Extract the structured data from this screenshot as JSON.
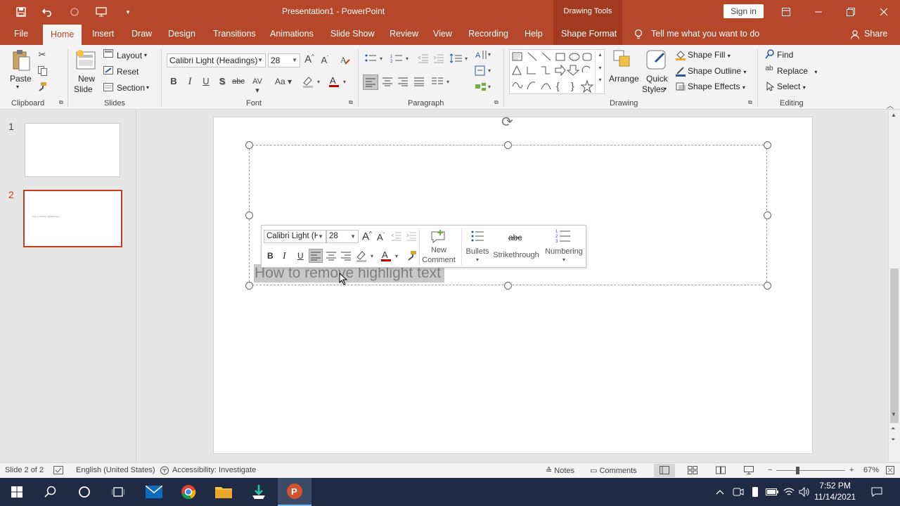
{
  "window": {
    "title": "Presentation1  -  PowerPoint",
    "context_tab_group": "Drawing Tools",
    "signin_label": "Sign in"
  },
  "tabs": [
    "File",
    "Home",
    "Insert",
    "Draw",
    "Design",
    "Transitions",
    "Animations",
    "Slide Show",
    "Review",
    "View",
    "Recording",
    "Help",
    "Shape Format"
  ],
  "tell_me": "Tell me what you want to do",
  "share_label": "Share",
  "ribbon": {
    "clipboard": {
      "paste": "Paste",
      "group": "Clipboard"
    },
    "slides": {
      "new_slide_1": "New",
      "new_slide_2": "Slide",
      "layout": "Layout",
      "reset": "Reset",
      "section": "Section",
      "group": "Slides"
    },
    "font": {
      "font_name": "Calibri Light (Headings)",
      "font_size": "28",
      "bold": "B",
      "italic": "I",
      "underline": "U",
      "shadow": "S",
      "strike": "abc",
      "spacing": "AV",
      "case": "Aa",
      "group": "Font"
    },
    "paragraph": {
      "group": "Paragraph"
    },
    "drawing": {
      "arrange": "Arrange",
      "quick_styles_1": "Quick",
      "quick_styles_2": "Styles",
      "shape_fill": "Shape Fill",
      "shape_outline": "Shape Outline",
      "shape_effects": "Shape Effects",
      "group": "Drawing"
    },
    "editing": {
      "find": "Find",
      "replace": "Replace",
      "select": "Select",
      "group": "Editing"
    }
  },
  "thumbnails": [
    {
      "num": "1",
      "text": ""
    },
    {
      "num": "2",
      "text": "How to remove highlight text"
    }
  ],
  "slide": {
    "text": "How to remove highlight text"
  },
  "minibar": {
    "font_name": "Calibri Light (H",
    "font_size": "28",
    "new_comment_1": "New",
    "new_comment_2": "Comment",
    "bullets": "Bullets",
    "strikethrough": "Strikethrough",
    "numbering": "Numbering",
    "bold": "B",
    "italic": "I",
    "underline": "U"
  },
  "status": {
    "slide_info": "Slide 2 of 2",
    "language": "English (United States)",
    "accessibility": "Accessibility: Investigate",
    "notes": "Notes",
    "comments": "Comments",
    "zoom": "67%"
  },
  "taskbar": {
    "time": "7:52 PM",
    "date": "11/14/2021"
  },
  "colors": {
    "accent": "#b7472a",
    "taskbar": "#1f2a44"
  }
}
